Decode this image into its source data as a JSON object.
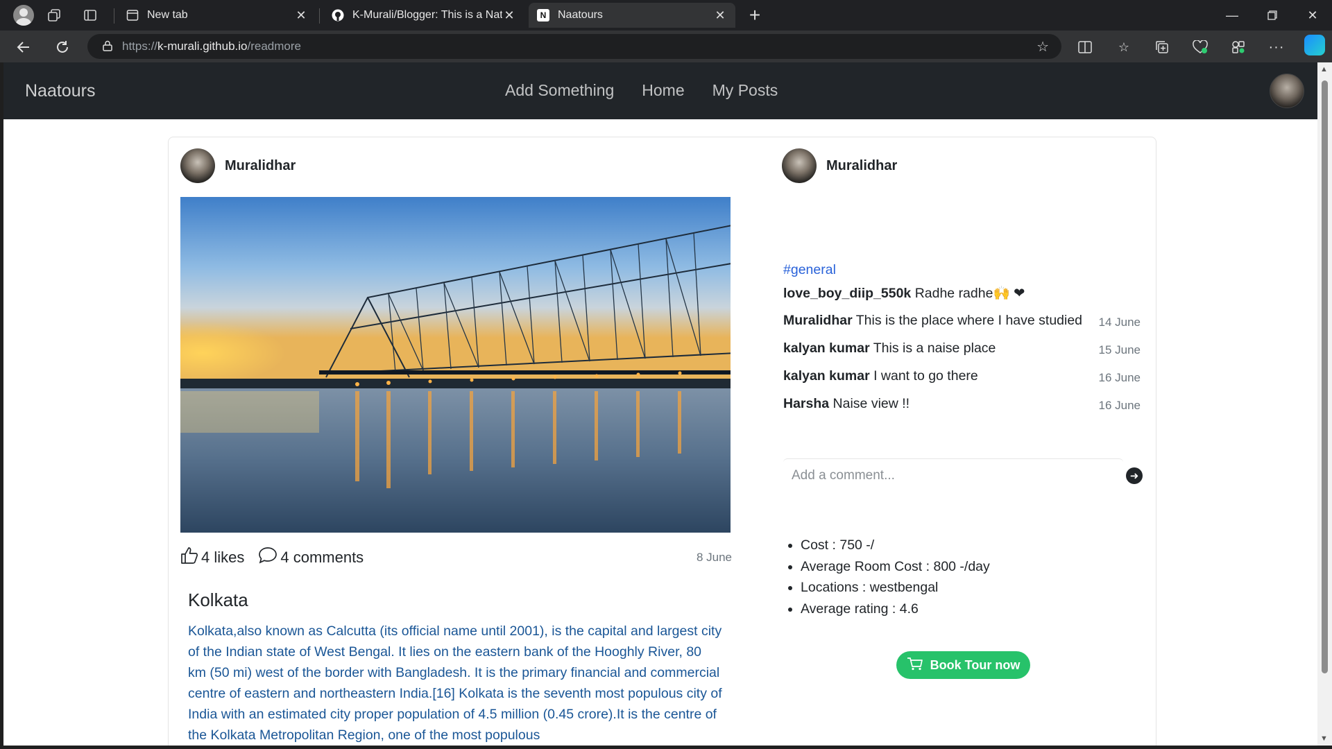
{
  "browser": {
    "tabs": [
      {
        "title": "New tab",
        "favicon": "new-tab-icon"
      },
      {
        "title": "K-Murali/Blogger: This is a Natou",
        "favicon": "github-icon"
      },
      {
        "title": "Naatours",
        "favicon": "naatours-icon"
      }
    ],
    "url_prefix": "https://",
    "url_host": "k-murali.github.io",
    "url_path": "/readmore"
  },
  "site": {
    "brand": "Naatours",
    "nav": [
      "Add Something",
      "Home",
      "My Posts"
    ]
  },
  "post": {
    "author": "Muralidhar",
    "likes": "4 likes",
    "comments_count": "4 comments",
    "date": "8 June",
    "title": "Kolkata",
    "body": "Kolkata,also known as Calcutta (its official name until 2001), is the capital and largest city of the Indian state of West Bengal. It lies on the eastern bank of the Hooghly River, 80 km (50 mi) west of the border with Bangladesh. It is the primary financial and commercial centre of eastern and northeastern India.[16] Kolkata is the seventh most populous city of India with an estimated city proper population of 4.5 million (0.45 crore).It is the centre of the Kolkata Metropolitan Region, one of the most populous"
  },
  "side": {
    "author": "Muralidhar",
    "tag": "#general",
    "caption": {
      "user": "love_boy_diip_550k",
      "text": "Radhe radhe",
      "emoji": "🙌 ❤"
    },
    "comments": [
      {
        "user": "Muralidhar",
        "text": "This is the place where I have studied",
        "date": "14 June"
      },
      {
        "user": "kalyan kumar",
        "text": "This is a naise place",
        "date": "15 June"
      },
      {
        "user": "kalyan kumar",
        "text": "I want to go there",
        "date": "16 June"
      },
      {
        "user": "Harsha",
        "text": "Naise view !!",
        "date": "16 June"
      }
    ],
    "comment_placeholder": "Add a comment...",
    "facts": [
      "Cost : 750 -/",
      "Average Room Cost : 800 -/day",
      "Locations : westbengal",
      "Average rating : 4.6"
    ],
    "book_label": "Book Tour now"
  }
}
